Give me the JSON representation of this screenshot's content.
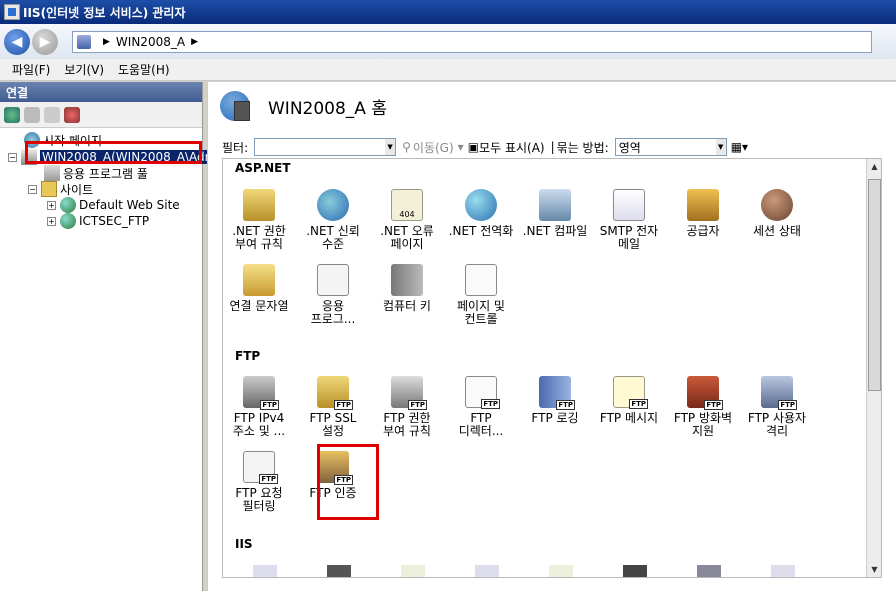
{
  "window": {
    "title": "IIS(인터넷 정보 서비스) 관리자"
  },
  "address": {
    "crumbs": [
      "WIN2008_A"
    ]
  },
  "menu": [
    "파일(F)",
    "보기(V)",
    "도움말(H)"
  ],
  "left": {
    "header": "연결",
    "tree": [
      {
        "label": "시작 페이지",
        "icon": "start-page-icon"
      },
      {
        "label": "WIN2008_A(WIN2008_A\\Adr",
        "icon": "server-icon",
        "selected": true
      },
      {
        "label": "응용 프로그램 풀",
        "icon": "app-pool-icon"
      },
      {
        "label": "사이트",
        "icon": "sites-folder-icon"
      },
      {
        "label": "Default Web Site",
        "icon": "globe-icon"
      },
      {
        "label": "ICTSEC_FTP",
        "icon": "globe-icon"
      }
    ]
  },
  "main": {
    "title": "WIN2008_A 홈",
    "filter_label": "필터:",
    "go_label": "이동(G)",
    "show_all_label": "모두 표시(A)",
    "group_label": "묶는 방법:",
    "group_value": "영역",
    "sections": {
      "aspnet": "ASP.NET",
      "ftp": "FTP",
      "iis": "IIS"
    },
    "aspnet_features": [
      [
        ".NET 권한",
        "부여 규칙"
      ],
      [
        ".NET 신뢰",
        "수준"
      ],
      [
        ".NET 오류",
        "페이지"
      ],
      [
        ".NET 전역화",
        ""
      ],
      [
        ".NET 컴파일",
        ""
      ],
      [
        "SMTP 전자",
        "메일"
      ],
      [
        "공급자",
        ""
      ],
      [
        "세션 상태",
        ""
      ],
      [
        "연결 문자열",
        ""
      ],
      [
        "응용",
        "프로그..."
      ],
      [
        "컴퓨터 키",
        ""
      ],
      [
        "페이지 및",
        "컨트롤"
      ]
    ],
    "ftp_features": [
      [
        "FTP IPv4",
        "주소 및 ..."
      ],
      [
        "FTP SSL",
        "설정"
      ],
      [
        "FTP 권한",
        "부여 규칙"
      ],
      [
        "FTP",
        "디렉터..."
      ],
      [
        "FTP 로깅",
        ""
      ],
      [
        "FTP 메시지",
        ""
      ],
      [
        "FTP 방화벽",
        "지원"
      ],
      [
        "FTP 사용자",
        "격리"
      ],
      [
        "FTP 요청",
        "필터링"
      ],
      [
        "FTP 인증",
        ""
      ]
    ],
    "ftp_badge": "FTP",
    "iis_badge_404": "404"
  },
  "colors": {
    "selection": "#0a246a",
    "highlight": "#e00000",
    "title": "#0a2a7a"
  }
}
